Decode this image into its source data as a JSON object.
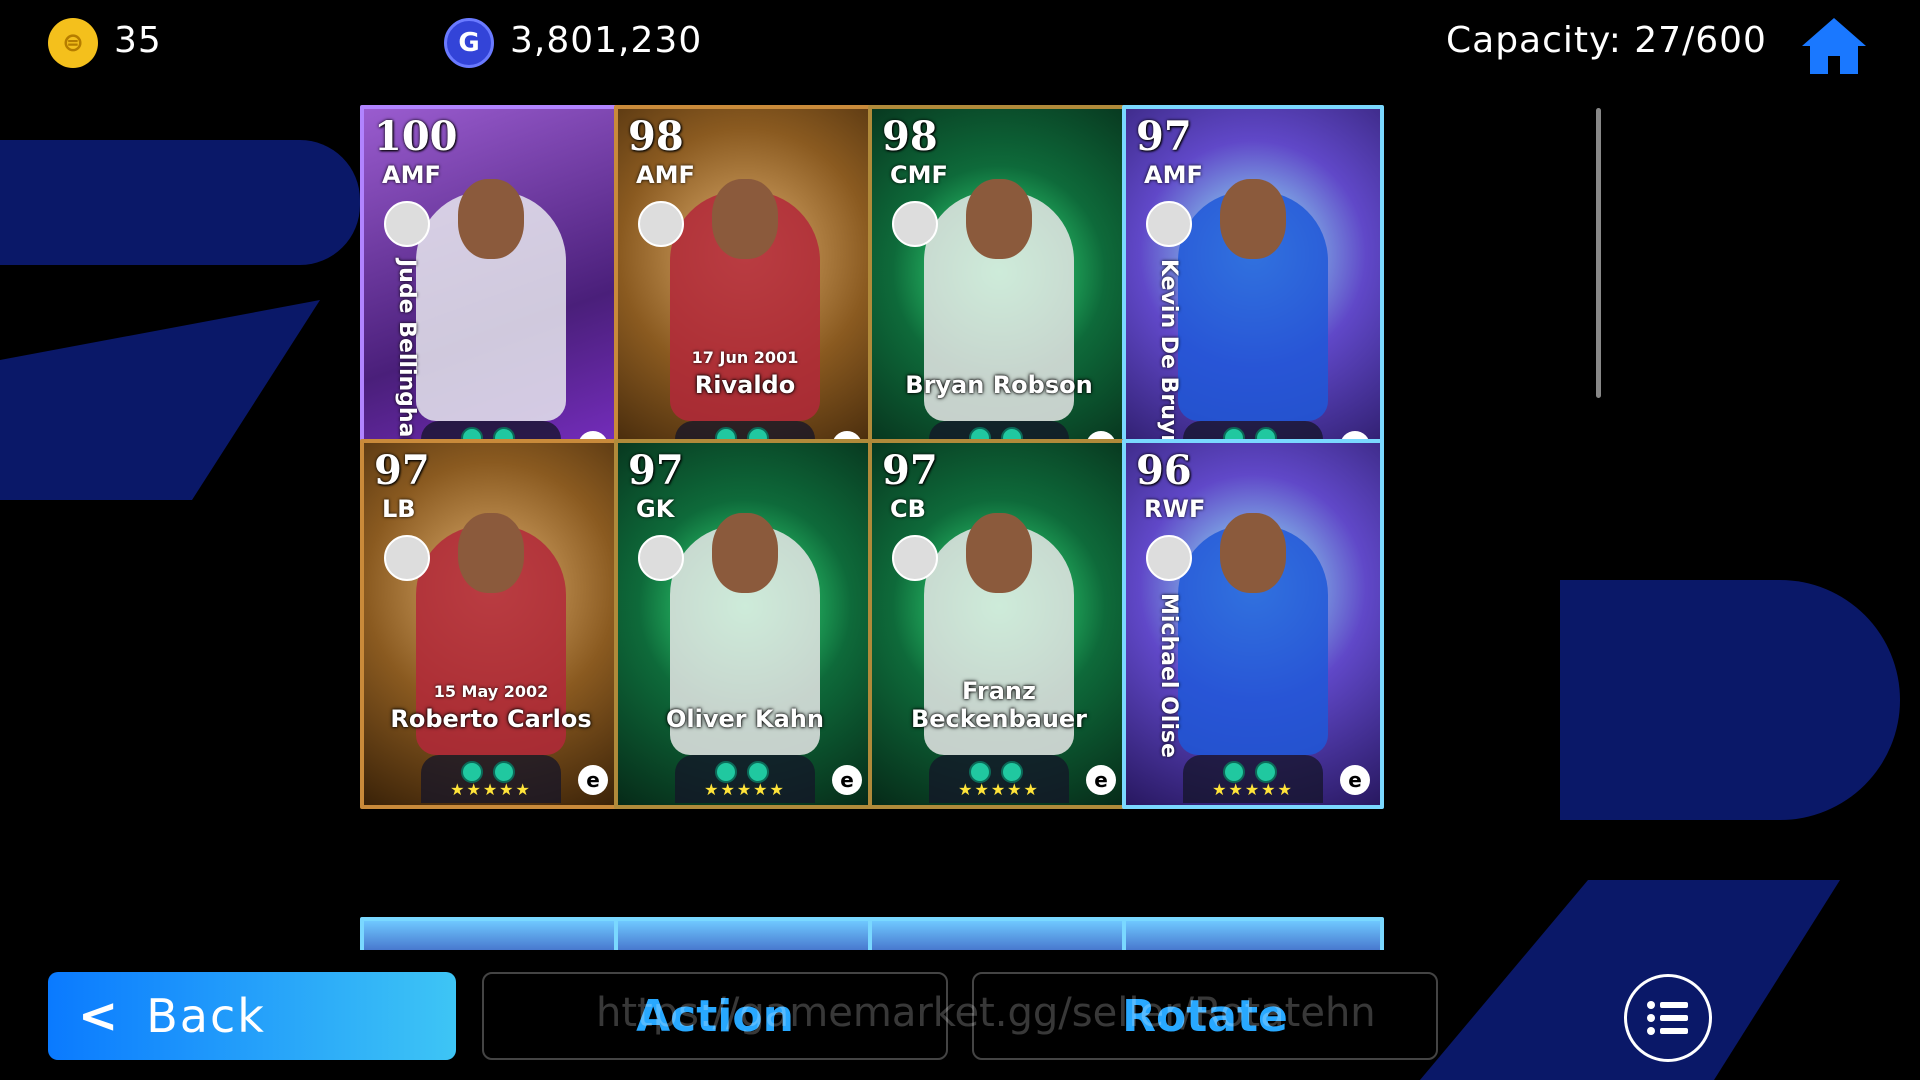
{
  "header": {
    "coins": "35",
    "gp": "3,801,230",
    "capacity": "Capacity: 27/600",
    "coin_icon": "coin-icon",
    "gp_icon": "gp-icon",
    "home_icon": "home-icon"
  },
  "cards": [
    {
      "rating": "100",
      "position": "AMF",
      "name": "Jude Bellingham",
      "date": "",
      "vertical": true,
      "theme": "purple"
    },
    {
      "rating": "98",
      "position": "AMF",
      "name": "Rivaldo",
      "date": "17 Jun 2001",
      "vertical": false,
      "theme": "gold"
    },
    {
      "rating": "98",
      "position": "CMF",
      "name": "Bryan Robson",
      "date": "",
      "vertical": false,
      "theme": "green"
    },
    {
      "rating": "97",
      "position": "AMF",
      "name": "Kevin De Bruyne",
      "date": "",
      "vertical": true,
      "theme": "electric"
    },
    {
      "rating": "97",
      "position": "LB",
      "name": "Roberto Carlos",
      "date": "15 May 2002",
      "vertical": false,
      "theme": "gold"
    },
    {
      "rating": "97",
      "position": "GK",
      "name": "Oliver Kahn",
      "date": "",
      "vertical": false,
      "theme": "green"
    },
    {
      "rating": "97",
      "position": "CB",
      "name": "Franz Beckenbauer",
      "date": "",
      "vertical": false,
      "theme": "green"
    },
    {
      "rating": "96",
      "position": "RWF",
      "name": "Michael Olise",
      "date": "",
      "vertical": true,
      "theme": "electric"
    }
  ],
  "stars": "★★★★★",
  "footer": {
    "back_label": "Back",
    "action_label": "Action",
    "rotate_label": "Rotate",
    "watermark": "https://gamemarket.gg/seller/Rotatehn"
  },
  "colors": {
    "accent_blue": "#28a8ff",
    "back_gradient_start": "#0a7aff",
    "back_gradient_end": "#3ec5f5",
    "star": "#ffe43a"
  }
}
